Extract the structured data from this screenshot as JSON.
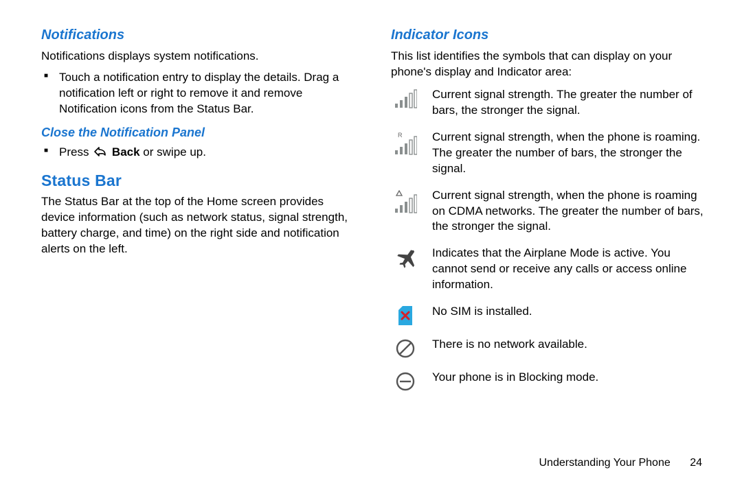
{
  "left": {
    "notifications_heading": "Notifications",
    "notifications_intro": "Notifications displays system notifications.",
    "notifications_bullet": "Touch a notification entry to display the details. Drag a notification left or right to remove it and remove Notification icons from the Status Bar.",
    "close_heading": "Close the Notification Panel",
    "close_bullet_prefix": "Press ",
    "close_bullet_bold": "Back",
    "close_bullet_suffix": " or swipe up.",
    "statusbar_heading": "Status Bar",
    "statusbar_body": "The Status Bar at the top of the Home screen provides device information (such as network status, signal strength, battery charge, and time) on the right side and notification alerts on the left."
  },
  "right": {
    "indicator_heading": "Indicator Icons",
    "indicator_intro": "This list identifies the symbols that can display on your phone's display and Indicator area:",
    "items": [
      {
        "icon": "signal",
        "desc": "Current signal strength. The greater the number of bars, the stronger the signal."
      },
      {
        "icon": "signal-roaming-r",
        "desc": "Current signal strength, when the phone is roaming. The greater the number of bars, the stronger the signal."
      },
      {
        "icon": "signal-roaming-tri",
        "desc": "Current signal strength, when the phone is roaming on CDMA networks. The greater the number of bars, the stronger the signal."
      },
      {
        "icon": "airplane",
        "desc": "Indicates that the Airplane Mode is active. You cannot send or receive any calls or access online information."
      },
      {
        "icon": "no-sim",
        "desc": "No SIM is installed."
      },
      {
        "icon": "no-network",
        "desc": "There is no network available."
      },
      {
        "icon": "blocking",
        "desc": "Your phone is in Blocking mode."
      }
    ]
  },
  "footer": {
    "section": "Understanding Your Phone",
    "page": "24"
  }
}
